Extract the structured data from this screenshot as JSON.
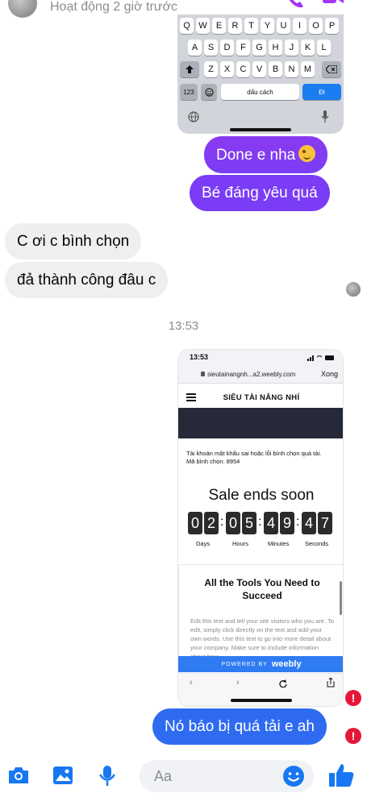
{
  "header": {
    "status": "Hoạt động 2 giờ trước",
    "call_icon": "phone-icon",
    "video_icon": "video-icon"
  },
  "keyboard_screenshot": {
    "row1": [
      "Q",
      "W",
      "E",
      "R",
      "T",
      "Y",
      "U",
      "I",
      "O",
      "P"
    ],
    "row2": [
      "A",
      "S",
      "D",
      "F",
      "G",
      "H",
      "J",
      "K",
      "L"
    ],
    "row3": [
      "Z",
      "X",
      "C",
      "V",
      "B",
      "N",
      "M"
    ],
    "num_key": "123",
    "space_key": "dấu cách",
    "go_key": "Đi"
  },
  "messages": {
    "m1": "Done e nha",
    "m2": "Bé đáng yêu quá",
    "m3": "C ơi c bình chọn",
    "m4": "đả thành công đâu c",
    "timestamp": "13:53",
    "m5": "Nó báo bị quá tải e ah",
    "error_mark": "!"
  },
  "web_screenshot": {
    "time": "13:53",
    "url": "sieutainangnh...a2.weebly.com",
    "done": "Xong",
    "brand": "SIÊU TÀI NĂNG NHÍ",
    "message_line1": "Tài khoản mật khẩu sai hoặc lỗi bình chọn quá tải.",
    "message_line2": "Mã bình chọn: 8954",
    "sale": "Sale ends soon",
    "timer_digits": [
      "0",
      "2",
      "0",
      "5",
      "4",
      "9",
      "4",
      "7"
    ],
    "timer_labels": [
      "Days",
      "Hours",
      "Minutes",
      "Seconds"
    ],
    "card_title": "All the Tools You Need to Succeed",
    "card_body": "Edit this text and tell your site visitors who you are. To edit, simply click directly on the text and add your own words. Use this text to go into more detail about your company. Make sure to include information about how",
    "powered_by": "POWERED BY",
    "powered_brand": "weebly"
  },
  "composer": {
    "placeholder": "Aa"
  },
  "colors": {
    "accent_purple": "#7a3cf5",
    "accent_blue": "#2f6bf0",
    "error_red": "#e4173a",
    "icon_blue": "#1877f2"
  }
}
